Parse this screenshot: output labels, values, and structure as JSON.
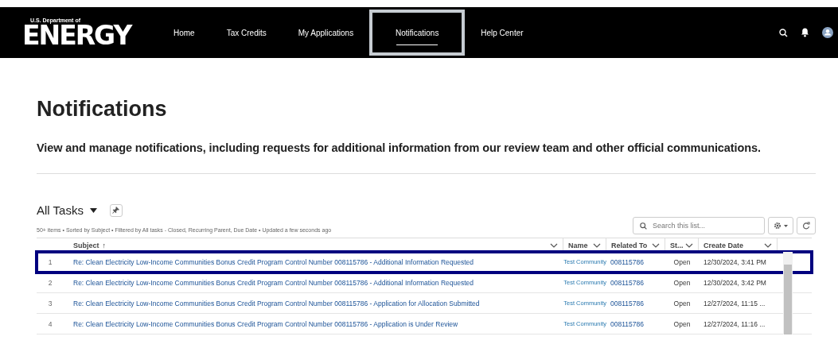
{
  "header": {
    "logo": {
      "agency": "U.S. Department of",
      "wordmark": "ENERGY"
    },
    "nav": [
      {
        "label": "Home",
        "selected": false,
        "highlighted": false
      },
      {
        "label": "Tax Credits",
        "selected": false,
        "highlighted": false
      },
      {
        "label": "My Applications",
        "selected": false,
        "highlighted": false
      },
      {
        "label": "Notifications",
        "selected": true,
        "highlighted": true
      },
      {
        "label": "Help Center",
        "selected": false,
        "highlighted": false
      }
    ]
  },
  "page": {
    "title": "Notifications",
    "description": "View and manage notifications, including requests for additional information from our review team and other official communications."
  },
  "list_view": {
    "name": "All Tasks",
    "meta": "50+ items • Sorted by Subject • Filtered by All tasks - Closed, Recurring Parent, Due Date • Updated a few seconds ago",
    "search": {
      "placeholder": "Search this list..."
    },
    "table": {
      "columns": [
        {
          "label": "Subject",
          "sort_icon": "↑"
        },
        {
          "label": "Name"
        },
        {
          "label": "Related To"
        },
        {
          "label": "St..."
        },
        {
          "label": "Create Date"
        }
      ],
      "rows": [
        {
          "number": "1",
          "subject": "Re: Clean Electricity Low-Income Communities Bonus Credit Program Control Number 008115786 - Additional Information Requested",
          "name": "Test Community",
          "related_to": "008115786",
          "status": "Open",
          "create_date": "12/30/2024, 3:41 PM",
          "highlighted": true
        },
        {
          "number": "2",
          "subject": "Re: Clean Electricity Low-Income Communities Bonus Credit Program Control Number 008115786 - Additional Information Requested",
          "name": "Test Community",
          "related_to": "008115786",
          "status": "Open",
          "create_date": "12/30/2024, 3:42 PM",
          "highlighted": false
        },
        {
          "number": "3",
          "subject": "Re: Clean Electricity Low-Income Communities Bonus Credit Program Control Number 008115786 - Application for Allocation Submitted",
          "name": "Test Community",
          "related_to": "008115786",
          "status": "Open",
          "create_date": "12/27/2024, 11:15 ...",
          "highlighted": false
        },
        {
          "number": "4",
          "subject": "Re: Clean Electricity Low-Income Communities Bonus Credit Program Control Number 008115786 - Application is Under Review",
          "name": "Test Community",
          "related_to": "008115786",
          "status": "Open",
          "create_date": "12/27/2024, 11:16 ...",
          "highlighted": false
        }
      ]
    }
  }
}
